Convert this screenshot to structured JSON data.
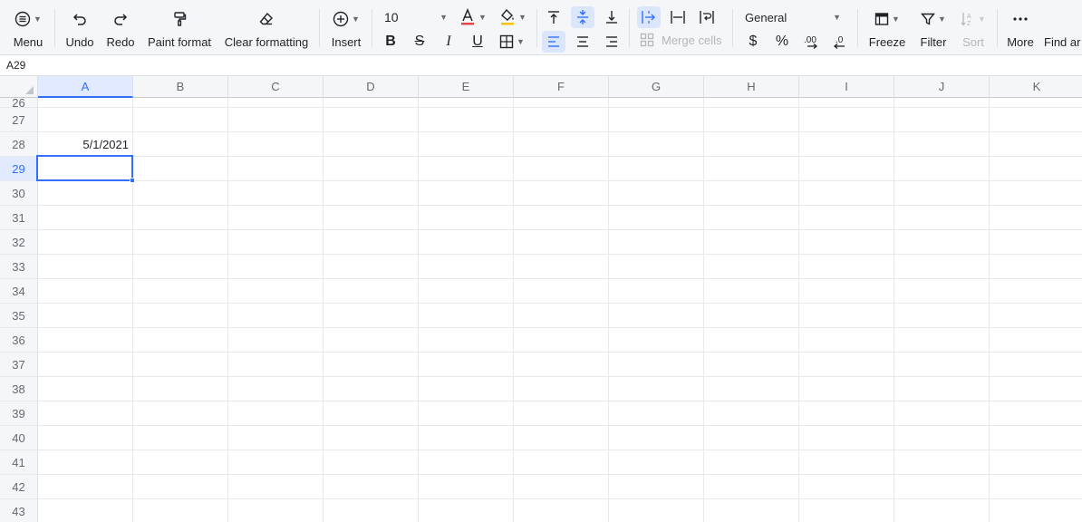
{
  "toolbar": {
    "menu_label": "Menu",
    "undo_label": "Undo",
    "redo_label": "Redo",
    "paint_format_label": "Paint format",
    "clear_formatting_label": "Clear formatting",
    "insert_label": "Insert",
    "font_size": "10",
    "number_format": "General",
    "merge_cells_label": "Merge cells",
    "currency_symbol": "$",
    "percent_symbol": "%",
    "freeze_label": "Freeze",
    "filter_label": "Filter",
    "sort_label": "Sort",
    "more_label": "More",
    "find_label": "Find ar",
    "colors": {
      "font_color_bar": "#e54545",
      "fill_color_bar": "#f5c400",
      "accent": "#3370ff"
    }
  },
  "formula_bar": {
    "cell_reference": "A29"
  },
  "grid": {
    "columns": [
      "A",
      "B",
      "C",
      "D",
      "E",
      "F",
      "G",
      "H",
      "I",
      "J",
      "K"
    ],
    "active_column": "A",
    "partial_top_row": "26",
    "rows": [
      "27",
      "28",
      "29",
      "30",
      "31",
      "32",
      "33",
      "34",
      "35",
      "36",
      "37",
      "38",
      "39",
      "40",
      "41",
      "42",
      "43"
    ],
    "active_row": "29",
    "cells": {
      "A28": "5/1/2021"
    },
    "selected_cell": "A29"
  }
}
